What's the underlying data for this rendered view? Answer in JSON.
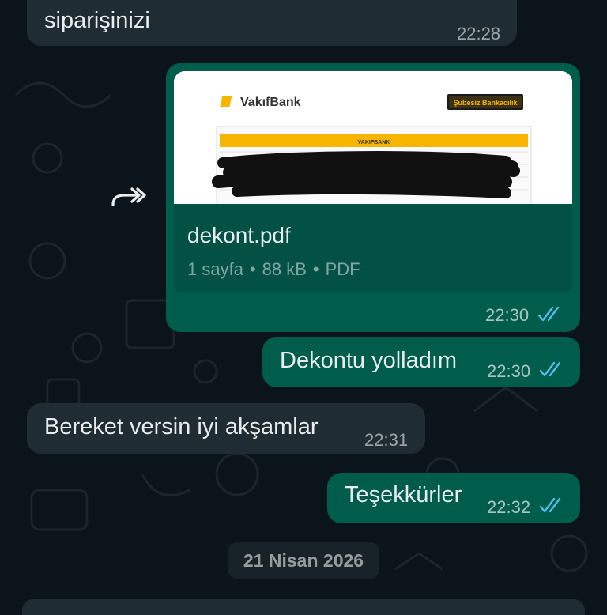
{
  "messages": [
    {
      "text": "siparişinizi",
      "time": "22:28",
      "direction": "incoming"
    },
    {
      "type": "document",
      "file_name": "dekont.pdf",
      "pages": "1 sayfa",
      "size": "88 kB",
      "file_type": "PDF",
      "time": "22:30",
      "direction": "outgoing",
      "read": true
    },
    {
      "text": "Dekontu yolladım",
      "time": "22:30",
      "direction": "outgoing",
      "read": true
    },
    {
      "text": "Bereket versin iyi akşamlar",
      "time": "22:31",
      "direction": "incoming"
    },
    {
      "text": "Teşekkürler",
      "time": "22:32",
      "direction": "outgoing",
      "read": true
    }
  ],
  "doc_preview": {
    "bank_name": "VakıfBank",
    "badge": "Şubesiz Bankacılık",
    "header": "VAKIFBANK"
  },
  "date_separator": "21 Nisan 2026",
  "icons": {
    "forward": "forward-icon",
    "read_receipt": "double-check-icon"
  },
  "colors": {
    "background": "#0b141a",
    "incoming_bubble": "#202c33",
    "outgoing_bubble": "#005c4b",
    "read_tick": "#53bdeb",
    "vakif_yellow": "#f7b500"
  }
}
